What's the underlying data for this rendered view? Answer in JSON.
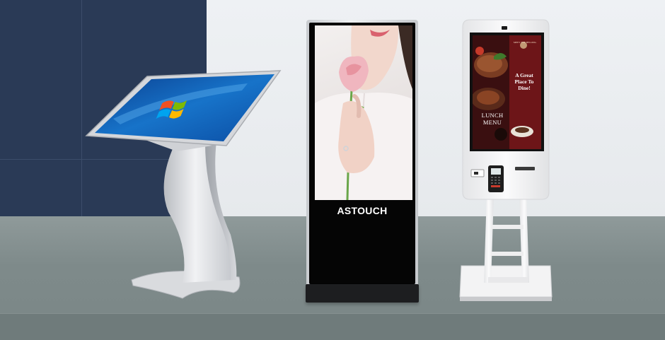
{
  "scene": {
    "kiosks": [
      {
        "id": "tilted-touch-table",
        "label": ""
      },
      {
        "id": "advertising-totem",
        "brand": "ASTOUCH"
      },
      {
        "id": "self-order-kiosk",
        "screen_greeting": "A Great Place To Dine!",
        "screen_menu": "LUNCH MENU",
        "screen_header": "MEET THE BELONG"
      }
    ]
  },
  "colors": {
    "wall_dark": "#2a3a56",
    "wall_light": "#eef1f4",
    "floor": "#8f9a9a",
    "totem_black": "#050505",
    "kiosk_white": "#f4f4f5"
  }
}
